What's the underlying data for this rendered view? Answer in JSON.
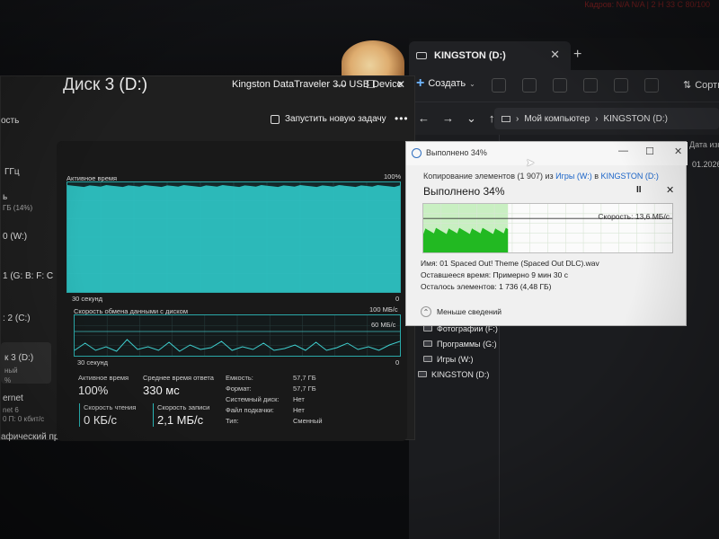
{
  "desktop": {
    "top_status": "Кадров: N/A  N/A  |  2 Н 33 С  80/100"
  },
  "explorer": {
    "tab_title": "KINGSTON (D:)",
    "tab_close": "✕",
    "new_tab": "+",
    "create_label": "Создать",
    "sort_label": "Сортир",
    "breadcrumb": [
      "Мой компьютер",
      "KINGSTON (D:)"
    ],
    "col_header": "Дата измен",
    "date_cell": "01.2026",
    "nav_items": [
      {
        "label": "Фотографии (F:)",
        "indent": true
      },
      {
        "label": "Программы (G:)",
        "indent": true
      },
      {
        "label": "Игры (W:)",
        "indent": true
      },
      {
        "label": "KINGSTON (D:)",
        "indent": false
      }
    ]
  },
  "taskmgr": {
    "window_controls": [
      "—",
      "☐",
      "✕"
    ],
    "partial_title": "ость",
    "new_task_label": "Запустить новую задачу",
    "more_label": "•••",
    "sidebar": [
      {
        "label": "ГГц",
        "top": 0
      },
      {
        "label": "ь",
        "top": 0
      },
      {
        "label": "ГБ (14%)",
        "top": 0
      },
      {
        "label": "0 (W:)",
        "top": 0
      },
      {
        "label": "1 (G: B: F: C",
        "top": 0
      },
      {
        "label": ": 2 (C:)",
        "top": 0
      },
      {
        "label": "к 3 (D:)",
        "top": 0
      },
      {
        "label": "ный",
        "top": 0
      },
      {
        "label": "%",
        "top": 0
      },
      {
        "label": "ernet",
        "top": 0
      },
      {
        "label": "net 6",
        "top": 0
      },
      {
        "label": "0 П: 0 кбит/с",
        "top": 0
      },
      {
        "label": "афический пр",
        "top": 0
      }
    ],
    "disk_title": "Диск 3 (D:)",
    "disk_model": "Kingston DataTraveler 3.0 USB Device",
    "active_chart": {
      "label": "Активное время",
      "max_label": "100%",
      "time_label": "30 секунд",
      "min_label": "0",
      "value_percent": 100
    },
    "transfer_chart": {
      "label": "Скорость обмена данными с диском",
      "max_label": "100 МБ/с",
      "ref_label": "60 МБ/с",
      "time_label": "30 секунд",
      "min_label": "0"
    },
    "stats": {
      "active_time_label": "Активное время",
      "active_time_value": "100%",
      "avg_response_label": "Среднее время ответа",
      "avg_response_value": "330 мс",
      "read_speed_label": "Скорость чтения",
      "read_speed_value": "0 КБ/с",
      "write_speed_label": "Скорость записи",
      "write_speed_value": "2,1 МБ/с"
    },
    "props": [
      {
        "label": "Емкость:",
        "value": "57,7 ГБ"
      },
      {
        "label": "Формат:",
        "value": "57,7 ГБ"
      },
      {
        "label": "Системный диск:",
        "value": "Нет"
      },
      {
        "label": "Файл подкачки:",
        "value": "Нет"
      },
      {
        "label": "Тип:",
        "value": "Сменный"
      }
    ]
  },
  "copy_dialog": {
    "title": "Выполнено 34%",
    "copy_prefix": "Копирование элементов (1 907) из ",
    "copy_src": "Игры (W:)",
    "copy_mid": " в ",
    "copy_dst": "KINGSTON (D:)",
    "progress_text": "Выполнено 34%",
    "progress_fraction": 0.34,
    "pause_label": "II",
    "close_label": "✕",
    "speed_label": "Скорость: 13,6 МБ/с",
    "name_line": "Имя: 01 Spaced Out! Theme (Spaced Out DLC).wav",
    "time_line": "Оставшееся время:  Примерно 9 мин 30 с",
    "items_line": "Осталось элементов:  1 736 (4,48 ГБ)",
    "less_label": "Меньше сведений"
  }
}
